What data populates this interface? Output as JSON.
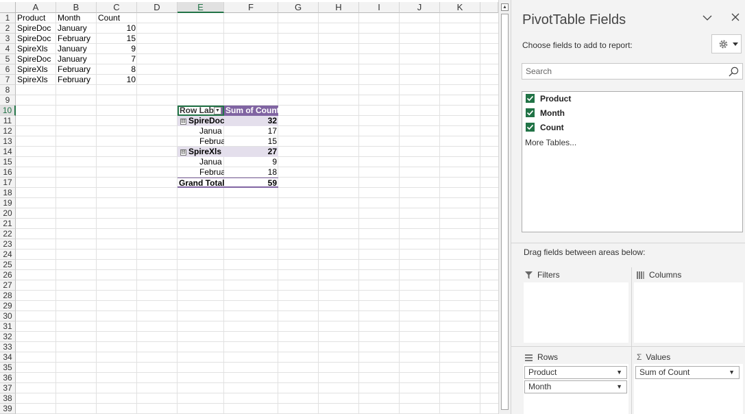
{
  "columns": [
    "A",
    "B",
    "C",
    "D",
    "E",
    "F",
    "G",
    "H",
    "I",
    "J",
    "K"
  ],
  "rows": [
    "1",
    "2",
    "3",
    "4",
    "5",
    "6",
    "7",
    "8",
    "9",
    "10",
    "11",
    "12",
    "13",
    "14",
    "15",
    "16",
    "17",
    "18",
    "19",
    "20",
    "21",
    "22",
    "23",
    "24",
    "25",
    "26",
    "27",
    "28",
    "29",
    "30",
    "31",
    "32",
    "33",
    "34",
    "35",
    "36",
    "37",
    "38",
    "39"
  ],
  "source_table": {
    "headers": [
      "Product",
      "Month",
      "Count"
    ],
    "rows": [
      [
        "SpireDoc",
        "January",
        "10"
      ],
      [
        "SpireDoc",
        "February",
        "15"
      ],
      [
        "SpireXls",
        "January",
        "9"
      ],
      [
        "SpireDoc",
        "January",
        "7"
      ],
      [
        "SpireXls",
        "February",
        "8"
      ],
      [
        "SpireXls",
        "February",
        "10"
      ]
    ]
  },
  "pivot": {
    "row_label_header": "Row Lab",
    "value_header": "Sum of Count",
    "rows": [
      {
        "label": "SpireDoc",
        "value": "32",
        "kind": "group",
        "toggle": "⊟"
      },
      {
        "label": "Janua",
        "value": "17",
        "kind": "item"
      },
      {
        "label": "Februa",
        "value": "15",
        "kind": "item"
      },
      {
        "label": "SpireXls",
        "value": "27",
        "kind": "group",
        "toggle": "⊟"
      },
      {
        "label": "Janua",
        "value": "9",
        "kind": "item"
      },
      {
        "label": "Februa",
        "value": "18",
        "kind": "item"
      }
    ],
    "grand_total_label": "Grand Total",
    "grand_total_value": "59",
    "header_color": "#8064a2",
    "group_color": "#e4dfec"
  },
  "pane": {
    "title": "PivotTable Fields",
    "choose_label": "Choose fields to add to report:",
    "search_placeholder": "Search",
    "fields": [
      {
        "label": "Product",
        "checked": true
      },
      {
        "label": "Month",
        "checked": true
      },
      {
        "label": "Count",
        "checked": true
      }
    ],
    "more_tables": "More Tables...",
    "drag_label": "Drag fields between areas below:",
    "areas": {
      "filters": {
        "label": "Filters",
        "items": []
      },
      "columns": {
        "label": "Columns",
        "items": []
      },
      "rows": {
        "label": "Rows",
        "items": [
          "Product",
          "Month"
        ]
      },
      "values": {
        "label": "Values",
        "items": [
          "Sum of Count"
        ]
      }
    },
    "accent_color": "#217346"
  },
  "icons": {
    "collapse": "chevron-down-icon",
    "close": "close-icon",
    "settings": "gear-icon",
    "search": "search-icon"
  }
}
